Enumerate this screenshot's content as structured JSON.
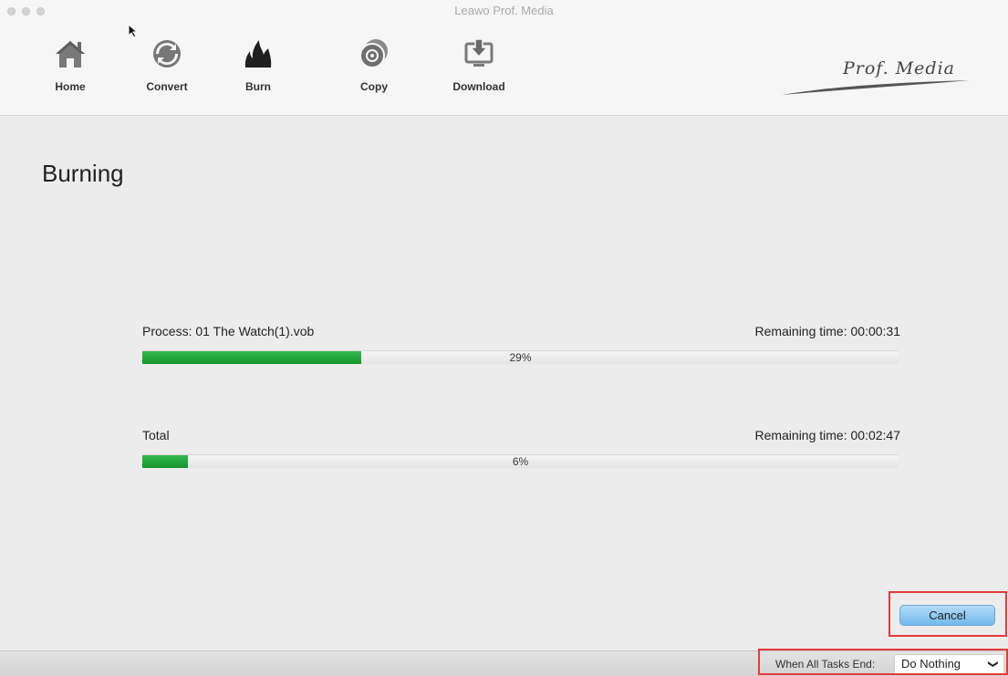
{
  "window": {
    "title": "Leawo Prof. Media"
  },
  "toolbar": {
    "items": [
      {
        "label": "Home",
        "icon": "home-icon"
      },
      {
        "label": "Convert",
        "icon": "convert-icon"
      },
      {
        "label": "Burn",
        "icon": "burn-icon"
      },
      {
        "label": "Copy",
        "icon": "copy-icon"
      },
      {
        "label": "Download",
        "icon": "download-icon"
      }
    ],
    "brand": "Prof. Media"
  },
  "main": {
    "heading": "Burning",
    "process": {
      "label": "Process:  01 The Watch(1).vob",
      "remaining": "Remaining time:  00:00:31",
      "percent_text": "29%",
      "progress": 0.29
    },
    "total": {
      "label": "Total",
      "remaining": "Remaining time:  00:02:47",
      "percent_text": "6%",
      "progress": 0.06
    },
    "cancel_label": "Cancel"
  },
  "statusbar": {
    "when_label": "When All Tasks End:",
    "when_value": "Do Nothing"
  },
  "colors": {
    "progress_fill": "#1ea538",
    "highlight": "#e63a3a",
    "button_blue": "#8ec9f0"
  }
}
